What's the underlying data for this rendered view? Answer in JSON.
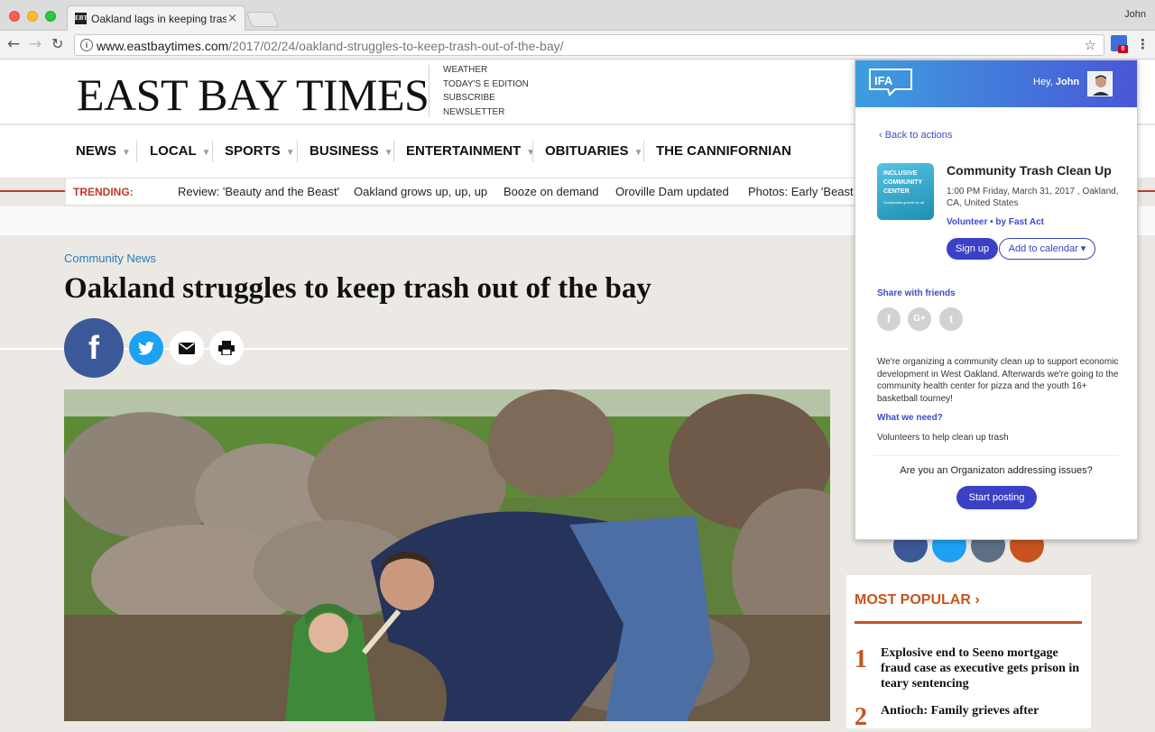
{
  "browser": {
    "tab_title": "Oakland lags in keeping trash",
    "tab_favicon_text": "EBT",
    "close_glyph": "×",
    "profile_name": "John",
    "url_host": "www.eastbaytimes.com",
    "url_path": "/2017/02/24/oakland-struggles-to-keep-trash-out-of-the-bay/",
    "extension_badge": "0",
    "icons": [
      "back-icon",
      "forward-icon",
      "reload-icon",
      "info-icon",
      "bookmark-star-icon",
      "extension-icon",
      "menu-icon"
    ]
  },
  "site": {
    "logo": "EAST BAY TIMES",
    "header_links": [
      "WEATHER",
      "TODAY'S E EDITION",
      "SUBSCRIBE",
      "NEWSLETTER"
    ],
    "nav": [
      {
        "label": "NEWS",
        "caret": true
      },
      {
        "label": "LOCAL",
        "caret": true
      },
      {
        "label": "SPORTS",
        "caret": true
      },
      {
        "label": "BUSINESS",
        "caret": true
      },
      {
        "label": "ENTERTAINMENT",
        "caret": true
      },
      {
        "label": "OBITUARIES",
        "caret": true
      },
      {
        "label": "THE CANNIFORNIAN",
        "caret": false
      }
    ],
    "trending_label": "TRENDING:",
    "trending": [
      "Review: 'Beauty and the Beast'",
      "Oakland grows up, up, up",
      "Booze on demand",
      "Oroville Dam updated",
      "Photos: Early 'Beast N"
    ],
    "accent_color": "#c0392b"
  },
  "article": {
    "section": "Community News",
    "headline": "Oakland struggles to keep trash out of the bay",
    "share_buttons": [
      "facebook-icon",
      "twitter-icon",
      "email-icon",
      "print-icon"
    ],
    "facebook_glyph": "f"
  },
  "most_popular": {
    "title": "MOST POPULAR ›",
    "items": [
      {
        "rank": "1",
        "text": "Explosive end to Seeno mortgage fraud case as executive gets prison in teary sentencing"
      },
      {
        "rank": "2",
        "text": "Antioch: Family grieves after"
      }
    ],
    "accent_color": "#c8531e"
  },
  "popup": {
    "greeting": "Hey,",
    "user": "John",
    "back_link": "‹ Back to actions",
    "thumb_title": "INCLUSIVE COMMUNITY CENTER",
    "thumb_sub": "Sustainable growth for all",
    "event_title": "Community Trash Clean Up",
    "event_time": "1:00 PM Friday, March 31, 2017 , Oakland, CA, United States",
    "event_by": "Volunteer • by Fast Act",
    "signup_label": "Sign up",
    "calendar_label": "Add to calendar ▾",
    "share_title": "Share with friends",
    "share_icons": [
      {
        "name": "facebook-icon",
        "glyph": "f"
      },
      {
        "name": "google-plus-icon",
        "glyph": "G+"
      },
      {
        "name": "twitter-icon",
        "glyph": "t"
      }
    ],
    "description": "We're organizing a community clean up to support economic development in West Oakland. Afterwards we're going to the community health center for pizza and the youth 16+ basketball tourney!",
    "need_title": "What we need?",
    "need_text": "Volunteers to help clean up trash",
    "org_question": "Are you an Organizaton addressing issues?",
    "start_label": "Start posting",
    "brand_color": "#3b41c5"
  }
}
